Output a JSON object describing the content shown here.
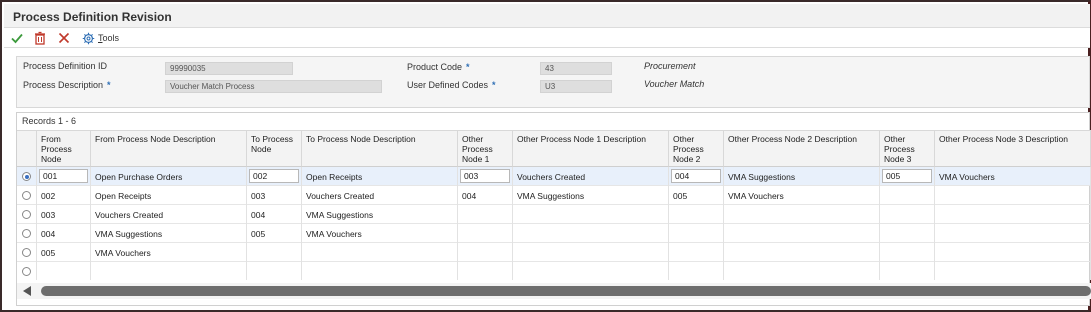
{
  "window": {
    "title": "Process Definition Revision"
  },
  "toolbar": {
    "ok_icon": "checkmark-icon",
    "delete_icon": "trash-icon",
    "cancel_icon": "close-icon",
    "tools_icon": "gear-icon",
    "tools_label": "ools",
    "tools_mnemonic": "T"
  },
  "header": {
    "process_definition_id": {
      "label": "Process Definition ID",
      "value": "99990035"
    },
    "process_description": {
      "label": "Process Description",
      "required": "*",
      "value": "Voucher Match Process"
    },
    "product_code": {
      "label": "Product Code",
      "required": "*",
      "value": "43",
      "description": "Procurement"
    },
    "user_defined_codes": {
      "label": "User Defined Codes",
      "required": "*",
      "value": "U3",
      "description": "Voucher Match"
    }
  },
  "grid": {
    "records_label": "Records 1 - 6",
    "columns": [
      "From Process Node",
      "From Process Node Description",
      "To Process Node",
      "To Process Node Description",
      "Other Process Node 1",
      "Other Process Node 1 Description",
      "Other Process Node 2",
      "Other Process Node 2 Description",
      "Other Process Node 3",
      "Other Process Node 3 Description"
    ],
    "rows": [
      {
        "selected": true,
        "cells": [
          "001",
          "Open Purchase Orders",
          "002",
          "Open Receipts",
          "003",
          "Vouchers Created",
          "004",
          "VMA Suggestions",
          "005",
          "VMA Vouchers"
        ]
      },
      {
        "selected": false,
        "cells": [
          "002",
          "Open Receipts",
          "003",
          "Vouchers Created",
          "004",
          "VMA Suggestions",
          "005",
          "VMA Vouchers",
          "",
          ""
        ]
      },
      {
        "selected": false,
        "cells": [
          "003",
          "Vouchers Created",
          "004",
          "VMA Suggestions",
          "",
          "",
          "",
          "",
          "",
          ""
        ]
      },
      {
        "selected": false,
        "cells": [
          "004",
          "VMA Suggestions",
          "005",
          "VMA Vouchers",
          "",
          "",
          "",
          "",
          "",
          ""
        ]
      },
      {
        "selected": false,
        "cells": [
          "005",
          "VMA Vouchers",
          "",
          "",
          "",
          "",
          "",
          "",
          "",
          ""
        ]
      },
      {
        "selected": false,
        "cells": [
          "",
          "",
          "",
          "",
          "",
          "",
          "",
          "",
          "",
          ""
        ]
      }
    ]
  },
  "colors": {
    "accent": "#2f6fb5",
    "ok": "#3c9a3c",
    "delete": "#c0392b",
    "selected_row": "#e8f0fb"
  }
}
